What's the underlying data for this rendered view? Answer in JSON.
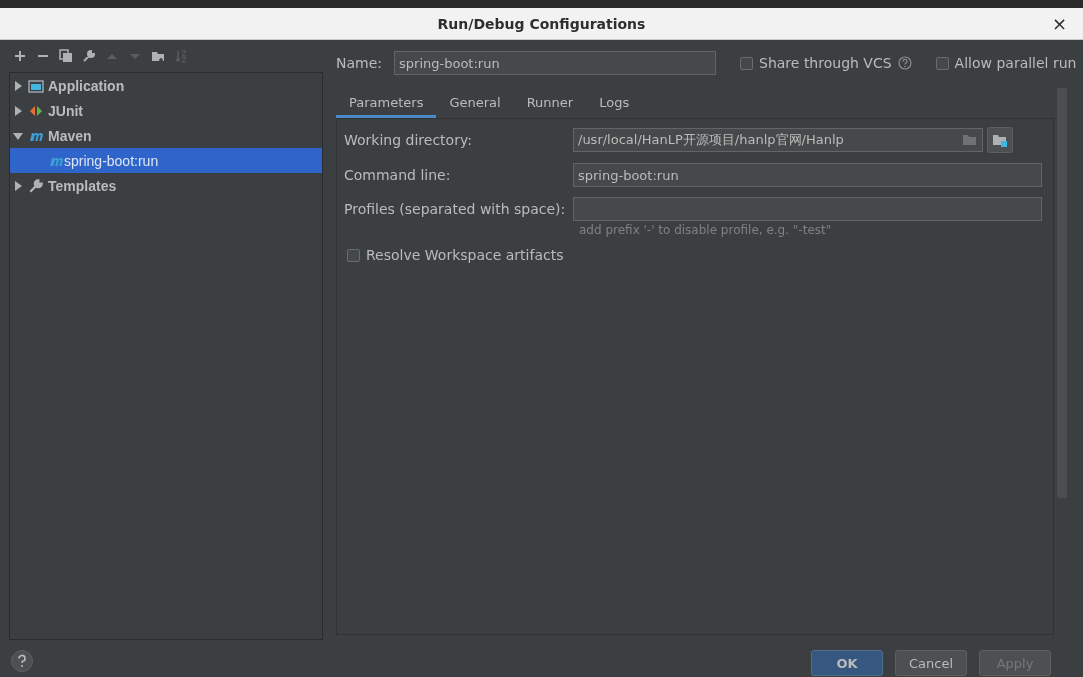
{
  "window": {
    "title": "Run/Debug Configurations",
    "close": "×"
  },
  "toolbar": [
    {
      "kind": "add"
    },
    {
      "kind": "remove"
    },
    {
      "kind": "copy"
    },
    {
      "kind": "wrench"
    },
    {
      "kind": "up",
      "disabled": true
    },
    {
      "kind": "down",
      "disabled": true
    },
    {
      "kind": "folder"
    },
    {
      "kind": "sort",
      "disabled": true
    }
  ],
  "tree": [
    {
      "label": "Application",
      "kind": "application",
      "expanded": false,
      "selected": false
    },
    {
      "label": "JUnit",
      "kind": "junit",
      "expanded": false,
      "selected": false
    },
    {
      "label": "Maven",
      "kind": "maven",
      "expanded": true,
      "selected": false,
      "children": [
        {
          "label": "spring-boot:run",
          "kind": "maven",
          "selected": true
        }
      ]
    },
    {
      "label": "Templates",
      "kind": "wrench",
      "expanded": false,
      "selected": false
    }
  ],
  "name_field": {
    "label": "Name:",
    "value": "spring-boot:run"
  },
  "options": [
    {
      "label": "Share through VCS",
      "checked": false,
      "help": true
    },
    {
      "label": "Allow parallel run",
      "checked": false,
      "help": false
    }
  ],
  "tabs": [
    {
      "label": "Parameters",
      "selected": true
    },
    {
      "label": "General",
      "selected": false
    },
    {
      "label": "Runner",
      "selected": false
    },
    {
      "label": "Logs",
      "selected": false
    }
  ],
  "fields": [
    {
      "label": "Working directory:",
      "value": "/usr/local/HanLP开源项目/hanlp官网/Hanlp",
      "kind": "directory"
    },
    {
      "label": "Command line:",
      "value": "spring-boot:run",
      "kind": "text"
    },
    {
      "label": "Profiles (separated with space):",
      "kind": "text",
      "hint": "add prefix '-' to disable profile, e.g. \"-test\""
    }
  ],
  "resolve_workspace": {
    "label": "Resolve Workspace artifacts",
    "checked": false
  },
  "buttons": [
    {
      "label": "OK",
      "kind": "default"
    },
    {
      "label": "Cancel",
      "kind": "normal"
    },
    {
      "label": "Apply",
      "kind": "disabled"
    }
  ]
}
